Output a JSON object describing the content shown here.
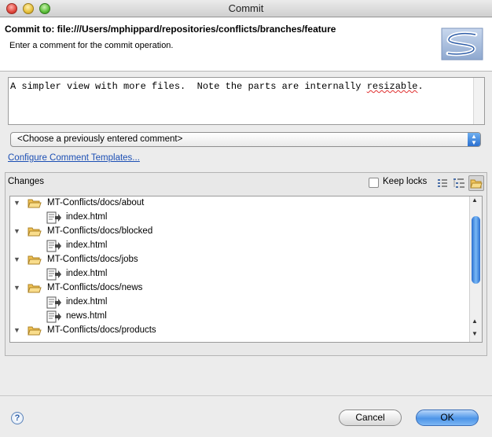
{
  "window": {
    "title": "Commit"
  },
  "header": {
    "title": "Commit to: file:///Users/mphippard/repositories/conflicts/branches/feature",
    "message": "Enter a comment for the commit operation."
  },
  "comment": {
    "text_before": "A simpler view with more files.  Note the parts are internally ",
    "text_misspelled": "resizable",
    "text_after": "."
  },
  "previous_comments": {
    "selected": "<Choose a previously entered comment>"
  },
  "templates_link": "Configure Comment Templates...",
  "changes": {
    "label": "Changes",
    "keep_locks_label": "Keep locks",
    "keep_locks_checked": false,
    "tree": [
      {
        "type": "folder",
        "label": "MT-Conflicts/docs/about",
        "expanded": true
      },
      {
        "type": "file",
        "label": "index.html"
      },
      {
        "type": "folder",
        "label": "MT-Conflicts/docs/blocked",
        "expanded": true
      },
      {
        "type": "file",
        "label": "index.html"
      },
      {
        "type": "folder",
        "label": "MT-Conflicts/docs/jobs",
        "expanded": true
      },
      {
        "type": "file",
        "label": "index.html"
      },
      {
        "type": "folder",
        "label": "MT-Conflicts/docs/news",
        "expanded": true
      },
      {
        "type": "file",
        "label": "index.html"
      },
      {
        "type": "file",
        "label": "news.html"
      },
      {
        "type": "folder",
        "label": "MT-Conflicts/docs/products",
        "expanded": true
      }
    ]
  },
  "buttons": {
    "cancel": "Cancel",
    "ok": "OK",
    "help": "?"
  }
}
